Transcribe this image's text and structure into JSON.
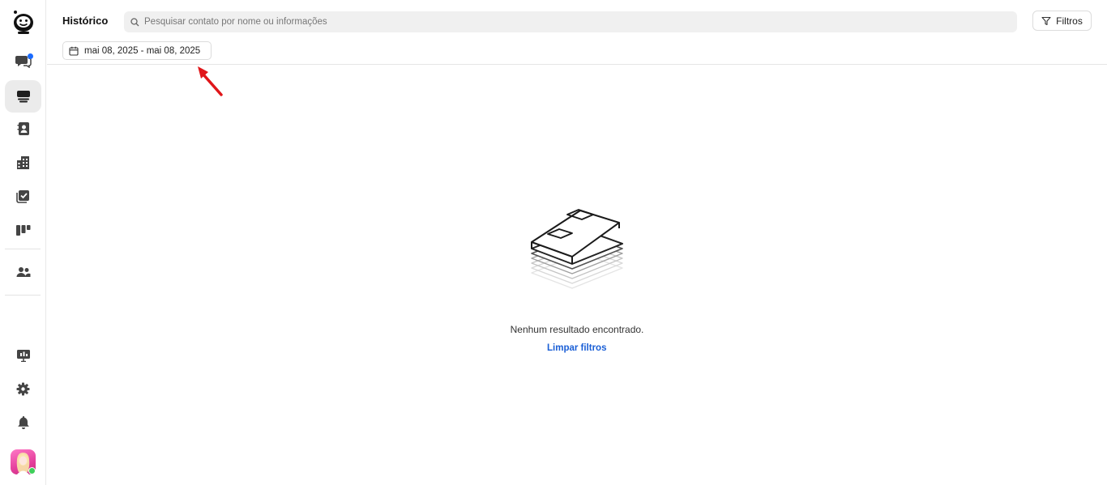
{
  "header": {
    "title": "Histórico",
    "search_placeholder": "Pesquisar contato por nome ou informações",
    "filters_label": "Filtros",
    "date_range": "mai 08, 2025 - mai 08, 2025"
  },
  "sidebar": {
    "items": [
      {
        "name": "logo",
        "icon": "bot-logo-icon"
      },
      {
        "name": "conversations",
        "icon": "chat-bubbles-icon",
        "badge": true
      },
      {
        "name": "history",
        "icon": "history-stack-icon",
        "active": true
      },
      {
        "name": "contacts",
        "icon": "contact-book-icon"
      },
      {
        "name": "companies",
        "icon": "building-icon"
      },
      {
        "name": "tasks",
        "icon": "task-check-icon"
      },
      {
        "name": "kanban",
        "icon": "kanban-icon"
      },
      {
        "name": "team",
        "icon": "users-icon"
      },
      {
        "name": "presentation",
        "icon": "presentation-board-icon"
      },
      {
        "name": "settings",
        "icon": "gear-icon"
      },
      {
        "name": "notifications",
        "icon": "bell-icon"
      }
    ]
  },
  "empty_state": {
    "message": "Nenhum resultado encontrado.",
    "clear_label": "Limpar filtros"
  },
  "colors": {
    "accent": "#1a5fd6",
    "badge": "#1a6bff",
    "online": "#3ecf5a",
    "annotation_arrow": "#e0161a"
  }
}
